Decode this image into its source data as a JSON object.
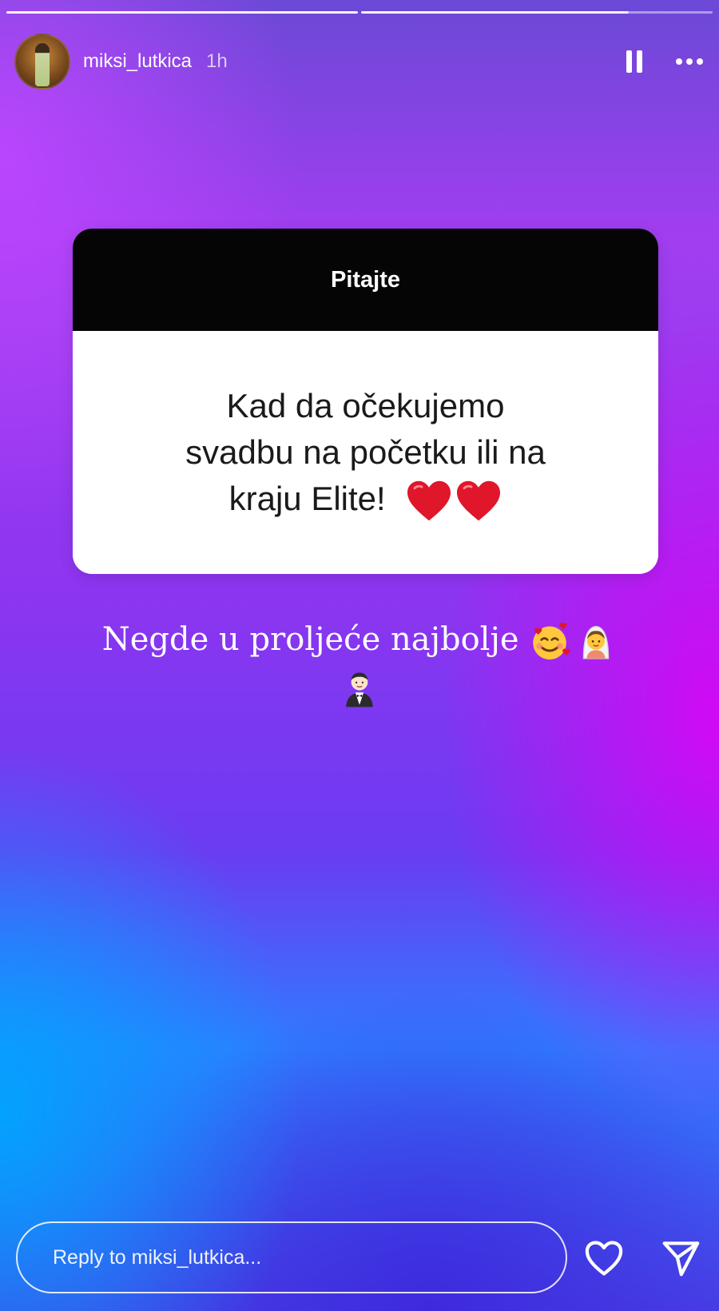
{
  "story": {
    "progress_segments": 2,
    "progress_fraction": 0.76
  },
  "header": {
    "username": "miksi_lutkica",
    "time_ago": "1h",
    "avatar_icon": "user-avatar",
    "pause_icon": "pause-icon",
    "more_icon": "more-horizontal-icon"
  },
  "question_sticker": {
    "title": "Pitajte",
    "question_lines": [
      "Kad da očekujemo",
      "svadbu na početku ili na",
      "kraju Elite!"
    ],
    "question_emoji": [
      "red-heart",
      "red-heart"
    ]
  },
  "answer": {
    "text": "Negde u proljeće  najbolje",
    "emoji": [
      "smiling-face-with-hearts",
      "bride-with-veil",
      "man-in-tuxedo"
    ]
  },
  "reply": {
    "placeholder": "Reply to miksi_lutkica...",
    "like_icon": "heart-outline-icon",
    "send_icon": "send-icon"
  },
  "colors": {
    "card_header": "#050505",
    "card_body": "#ffffff",
    "heart_red": "#e0162b"
  }
}
